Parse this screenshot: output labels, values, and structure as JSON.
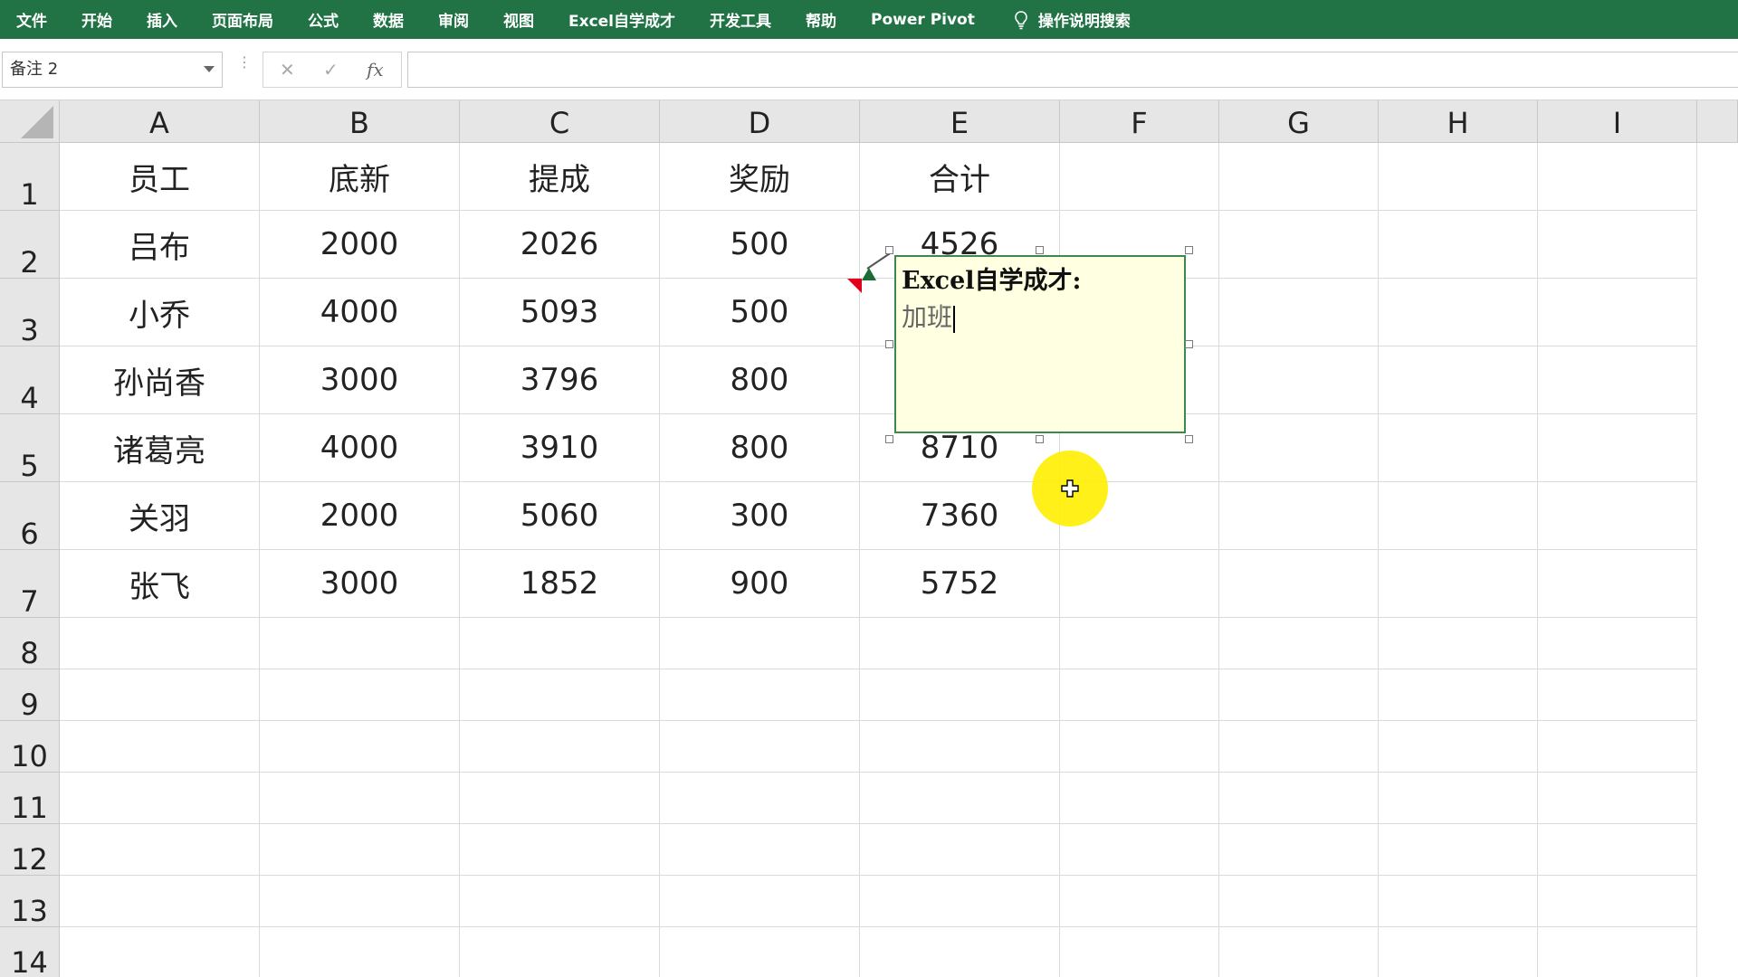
{
  "ribbon": {
    "tabs": [
      "文件",
      "开始",
      "插入",
      "页面布局",
      "公式",
      "数据",
      "审阅",
      "视图",
      "Excel自学成才",
      "开发工具",
      "帮助",
      "Power Pivot"
    ],
    "search_label": "操作说明搜索",
    "background": "#217346"
  },
  "formula_bar": {
    "name_box_value": "备注 2",
    "cancel_icon": "✕",
    "enter_icon": "✓",
    "fx_label": "fx",
    "formula_value": ""
  },
  "columns": [
    "A",
    "B",
    "C",
    "D",
    "E",
    "F",
    "G",
    "H",
    "I"
  ],
  "rows": [
    "1",
    "2",
    "3",
    "4",
    "5",
    "6",
    "7",
    "8",
    "9",
    "10",
    "11",
    "12",
    "13",
    "14"
  ],
  "table": {
    "header": [
      "员工",
      "底新",
      "提成",
      "奖励",
      "合计"
    ],
    "data": [
      [
        "吕布",
        "2000",
        "2026",
        "500",
        "4526"
      ],
      [
        "小乔",
        "4000",
        "5093",
        "500",
        ""
      ],
      [
        "孙尚香",
        "3000",
        "3796",
        "800",
        ""
      ],
      [
        "诸葛亮",
        "4000",
        "3910",
        "800",
        "8710"
      ],
      [
        "关羽",
        "2000",
        "5060",
        "300",
        "7360"
      ],
      [
        "张飞",
        "3000",
        "1852",
        "900",
        "5752"
      ]
    ]
  },
  "comment": {
    "author": "Excel自学成才:",
    "text": "加班",
    "border_color": "#3a8a4f",
    "fill_color": "#ffffe1"
  },
  "cursor_highlight_color": "#ffee00"
}
